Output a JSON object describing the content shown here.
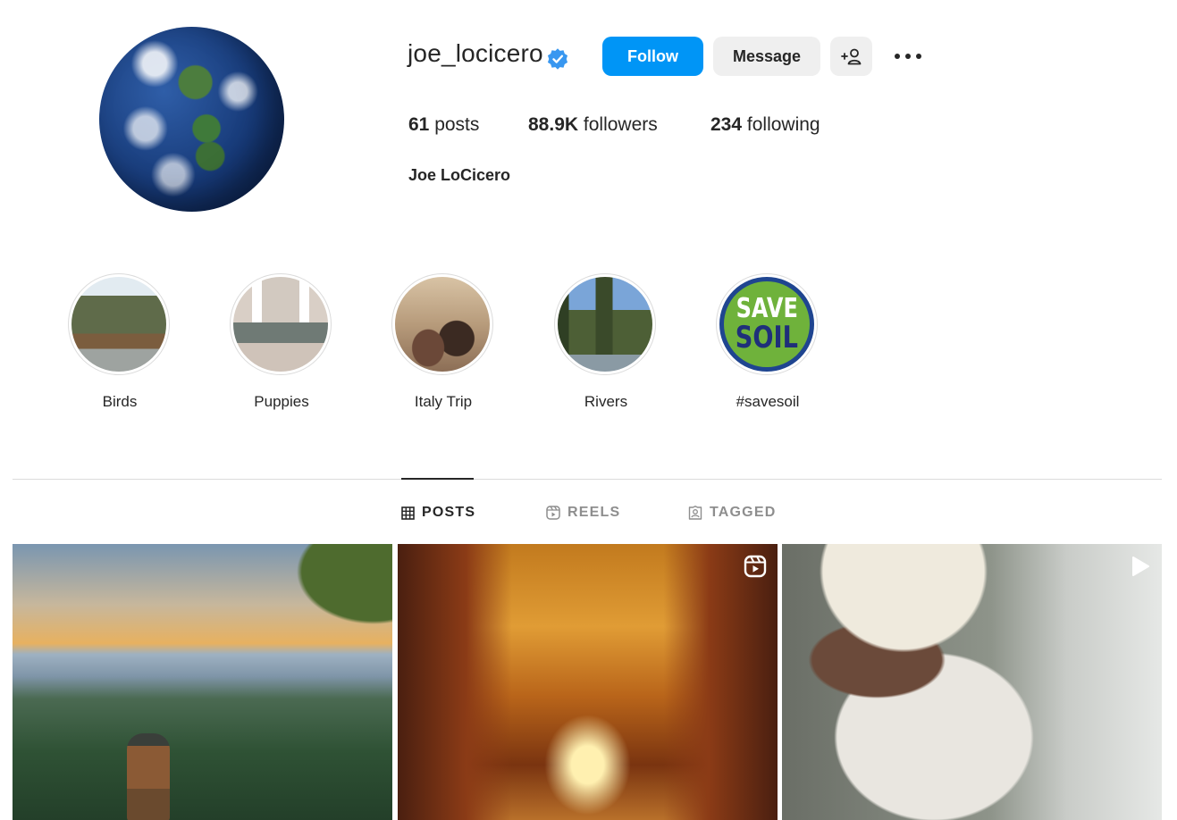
{
  "profile": {
    "username": "joe_locicero",
    "verified": true,
    "full_name": "Joe LoCicero",
    "avatar": "earth-globe-image",
    "stats": {
      "posts_count": "61",
      "posts_label": "posts",
      "followers_count": "88.9K",
      "followers_label": "followers",
      "following_count": "234",
      "following_label": "following"
    }
  },
  "actions": {
    "follow_label": "Follow",
    "message_label": "Message",
    "add_user_icon": "add-person-icon",
    "more_icon": "more-options-icon"
  },
  "highlights": [
    {
      "label": "Birds"
    },
    {
      "label": "Puppies"
    },
    {
      "label": "Italy Trip"
    },
    {
      "label": "Rivers"
    },
    {
      "label": "#savesoil",
      "badge_line1": "SAVE",
      "badge_line2": "SOIL"
    }
  ],
  "tabs": [
    {
      "label": "POSTS",
      "icon": "grid-icon",
      "active": true
    },
    {
      "label": "REELS",
      "icon": "reels-icon",
      "active": false
    },
    {
      "label": "TAGGED",
      "icon": "tagged-icon",
      "active": false
    }
  ],
  "posts": [
    {
      "subject": "sunset-forest-hiker",
      "type": "image"
    },
    {
      "subject": "vatican-gallery-hall",
      "type": "reel",
      "badge_icon": "reels-icon"
    },
    {
      "subject": "bearded-man-turban",
      "type": "video",
      "badge_icon": "play-icon"
    }
  ],
  "colors": {
    "accent": "#0095f6",
    "verified": "#3897f0",
    "text": "#262626",
    "muted": "#8e8e8e",
    "button_secondary": "#efefef",
    "divider": "#dbdbdb"
  }
}
